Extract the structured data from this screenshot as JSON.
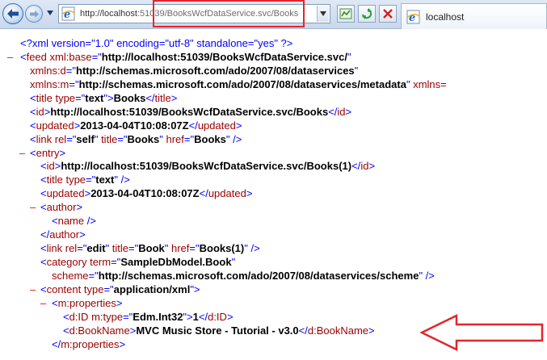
{
  "browser": {
    "url_host": "http://localhost",
    "url_rest": ":51039/BooksWcfDataService.svc/Books",
    "tab_title": "localhost"
  },
  "xml": {
    "decl": "<?xml version=\"1.0\" encoding=\"utf-8\" standalone=\"yes\" ?>",
    "feed_base_url": "http://localhost:51039/BooksWcfDataService.svc/",
    "ns_d": "http://schemas.microsoft.com/ado/2007/08/dataservices",
    "ns_m": "http://schemas.microsoft.com/ado/2007/08/dataservices/metadata",
    "title_type": "text",
    "title_text": "Books",
    "id_text": "http://localhost:51039/BooksWcfDataService.svc/Books",
    "updated_text": "2013-04-04T10:08:07Z",
    "link_rel": "self",
    "link_title": "Books",
    "link_href": "Books",
    "entry": {
      "id_text": "http://localhost:51039/BooksWcfDataService.svc/Books(1)",
      "title_type": "text",
      "updated_text": "2013-04-04T10:08:07Z",
      "link_rel": "edit",
      "link_title": "Book",
      "link_href": "Books(1)",
      "category_term": "SampleDbModel.Book",
      "category_scheme": "http://schemas.microsoft.com/ado/2007/08/dataservices/scheme",
      "content_type": "application/xml",
      "id_mtype": "Edm.Int32",
      "id_value": "1",
      "bookname_value": "MVC Music Store - Tutorial - v3.0"
    }
  },
  "colors": {
    "highlight": "#e2262b",
    "markup": "#0000ff",
    "name": "#990000"
  }
}
